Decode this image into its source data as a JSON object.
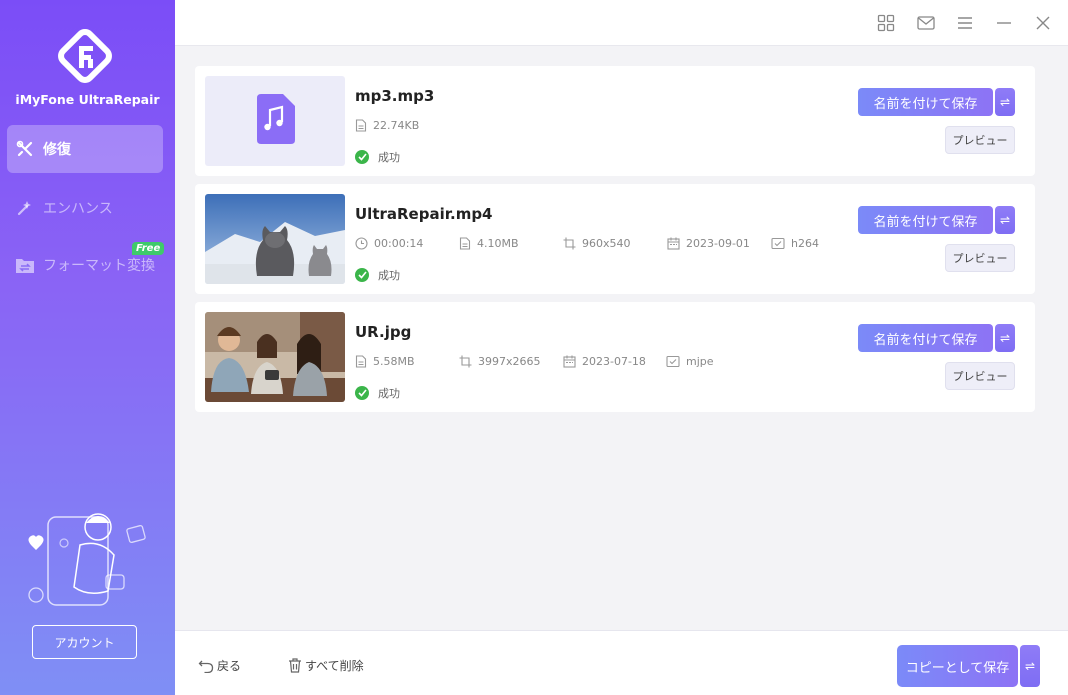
{
  "app": {
    "name": "iMyFone UltraRepair"
  },
  "sidebar": {
    "items": [
      {
        "label": "修復",
        "icon": "repair-tools-icon",
        "active": true
      },
      {
        "label": "エンハンス",
        "icon": "magic-wand-icon",
        "active": false
      },
      {
        "label": "フォーマット変換",
        "icon": "format-convert-icon",
        "active": false,
        "badge": "Free"
      }
    ],
    "account_label": "アカウント"
  },
  "topbar": {
    "icons": [
      "grid-icon",
      "mail-icon",
      "menu-icon",
      "minimize-icon",
      "close-icon"
    ]
  },
  "files": [
    {
      "name": "mp3.mp3",
      "thumb": "music-note-icon",
      "meta": [
        {
          "icon": "file-size-icon",
          "value": "22.74KB"
        }
      ],
      "status": "成功",
      "save_label": "名前を付けて保存",
      "swap_label": "⇌",
      "preview_label": "プレビュー"
    },
    {
      "name": "UltraRepair.mp4",
      "thumb": "cats-in-snow-photo",
      "meta": [
        {
          "icon": "clock-icon",
          "value": "00:00:14"
        },
        {
          "icon": "file-size-icon",
          "value": "4.10MB"
        },
        {
          "icon": "crop-icon",
          "value": "960x540"
        },
        {
          "icon": "calendar-icon",
          "value": "2023-09-01"
        },
        {
          "icon": "codec-icon",
          "value": "h264"
        }
      ],
      "status": "成功",
      "save_label": "名前を付けて保存",
      "swap_label": "⇌",
      "preview_label": "プレビュー"
    },
    {
      "name": "UR.jpg",
      "thumb": "people-at-cafe-photo",
      "meta": [
        {
          "icon": "file-size-icon",
          "value": "5.58MB"
        },
        {
          "icon": "crop-icon",
          "value": "3997x2665"
        },
        {
          "icon": "calendar-icon",
          "value": "2023-07-18"
        },
        {
          "icon": "codec-icon",
          "value": "mjpe"
        }
      ],
      "status": "成功",
      "save_label": "名前を付けて保存",
      "swap_label": "⇌",
      "preview_label": "プレビュー"
    }
  ],
  "bottombar": {
    "back_label": "戻る",
    "delete_all_label": "すべて削除",
    "copy_save_label": "コピーとして保存",
    "swap_label": "⇌"
  },
  "colors": {
    "accent": "#8a63f5",
    "button_gradient_start": "#7b8af8",
    "button_gradient_end": "#8d73f5",
    "success": "#3bb54a",
    "badge_free": "#3fca6b"
  }
}
